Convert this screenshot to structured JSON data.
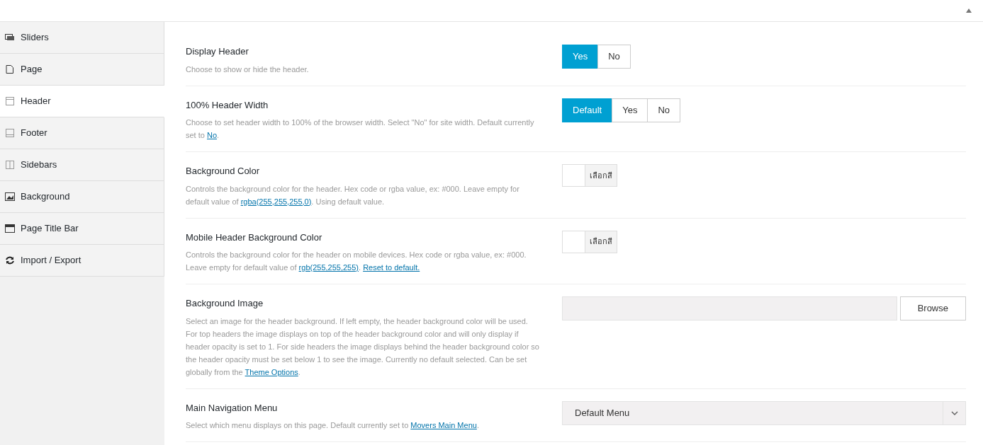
{
  "sidebar": {
    "items": [
      {
        "label": "Sliders",
        "selected": false
      },
      {
        "label": "Page",
        "selected": false
      },
      {
        "label": "Header",
        "selected": true
      },
      {
        "label": "Footer",
        "selected": false
      },
      {
        "label": "Sidebars",
        "selected": false
      },
      {
        "label": "Background",
        "selected": false
      },
      {
        "label": "Page Title Bar",
        "selected": false
      },
      {
        "label": "Import / Export",
        "selected": false
      }
    ]
  },
  "settings": [
    {
      "title": "Display Header",
      "description": [
        {
          "kind": "text",
          "text": "Choose to show or hide the header."
        }
      ],
      "control": {
        "kind": "toggle",
        "options": [
          {
            "label": "Yes",
            "selected": true
          },
          {
            "label": "No",
            "selected": false
          }
        ]
      }
    },
    {
      "title": "100% Header Width",
      "description": [
        {
          "kind": "text",
          "text": "Choose to set header width to 100% of the browser width. Select \"No\" for site width. Default currently set to "
        },
        {
          "kind": "link",
          "text": "No"
        },
        {
          "kind": "text",
          "text": "."
        }
      ],
      "control": {
        "kind": "toggle",
        "options": [
          {
            "label": "Default",
            "selected": true
          },
          {
            "label": "Yes",
            "selected": false
          },
          {
            "label": "No",
            "selected": false
          }
        ]
      }
    },
    {
      "title": "Background Color",
      "description": [
        {
          "kind": "text",
          "text": "Controls the background color for the header. Hex code or rgba value, ex: #000. Leave empty for default value of "
        },
        {
          "kind": "link",
          "text": "rgba(255,255,255,0)"
        },
        {
          "kind": "text",
          "text": ". Using default value."
        }
      ],
      "control": {
        "kind": "color",
        "button": "เลือกสี"
      }
    },
    {
      "title": "Mobile Header Background Color",
      "description": [
        {
          "kind": "text",
          "text": "Controls the background color for the header on mobile devices. Hex code or rgba value, ex: #000. Leave empty for default value of "
        },
        {
          "kind": "link",
          "text": "rgb(255,255,255)"
        },
        {
          "kind": "text",
          "text": ". "
        },
        {
          "kind": "link",
          "text": "Reset to default."
        }
      ],
      "control": {
        "kind": "color",
        "button": "เลือกสี"
      }
    },
    {
      "title": "Background Image",
      "description": [
        {
          "kind": "text",
          "text": "Select an image for the header background. If left empty, the header background color will be used. For top headers the image displays on top of the header background color and will only display if header opacity is set to 1. For side headers the image displays behind the header background color so the header opacity must be set below 1 to see the image. Currently no default selected. Can be set globally from the "
        },
        {
          "kind": "link",
          "text": "Theme Options"
        },
        {
          "kind": "text",
          "text": "."
        }
      ],
      "control": {
        "kind": "file",
        "button": "Browse"
      }
    },
    {
      "title": "Main Navigation Menu",
      "description": [
        {
          "kind": "text",
          "text": "Select which menu displays on this page. Default currently set to "
        },
        {
          "kind": "link",
          "text": "Movers Main Menu"
        },
        {
          "kind": "text",
          "text": "."
        }
      ],
      "control": {
        "kind": "select",
        "value": "Default Menu"
      }
    }
  ]
}
